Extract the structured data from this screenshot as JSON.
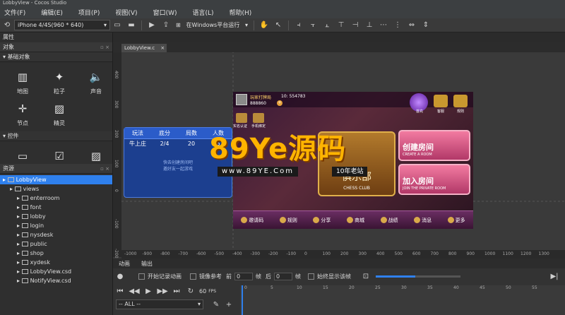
{
  "window": {
    "title": "LobbyView - Cocos Studio"
  },
  "menu": [
    "文件(F)",
    "编辑(E)",
    "项目(P)",
    "视图(V)",
    "窗口(W)",
    "语言(L)",
    "帮助(H)"
  ],
  "toolbar": {
    "device": "iPhone 4/4S(960 * 640)",
    "run_target": "在Windows平台运行"
  },
  "properties_label": "属性",
  "objects_panel": {
    "title": "对象",
    "basic_section": "基础对象",
    "basic_items": [
      {
        "label": "地图",
        "icon": "map-icon"
      },
      {
        "label": "粒子",
        "icon": "particle-icon"
      },
      {
        "label": "声音",
        "icon": "sound-icon"
      },
      {
        "label": "节点",
        "icon": "node-icon"
      },
      {
        "label": "精灵",
        "icon": "sprite-icon"
      }
    ],
    "controls_section": "控件",
    "control_items": [
      {
        "label": "按钮",
        "icon": "button-icon"
      },
      {
        "label": "复选框",
        "icon": "checkbox-icon"
      },
      {
        "label": "图片",
        "icon": "image-icon"
      }
    ]
  },
  "resources_panel": {
    "title": "资源",
    "root": "LobbyView",
    "items": [
      "views",
      "enterroom",
      "font",
      "lobby",
      "login",
      "nysdesk",
      "public",
      "shop",
      "xydesk",
      "LobbyView.csd",
      "NotifyView.csd"
    ]
  },
  "editor_tab": "LobbyView.c",
  "ruler": {
    "v_ticks": [
      "400",
      "300",
      "200",
      "100",
      "0",
      "-100",
      "-200"
    ],
    "h_ticks": [
      "-1000",
      "-900",
      "-800",
      "-700",
      "-600",
      "-500",
      "-400",
      "-300",
      "-200",
      "-100",
      "0",
      "100",
      "200",
      "300",
      "400",
      "500",
      "600",
      "700",
      "800",
      "900",
      "1000",
      "1100",
      "1200",
      "1300"
    ]
  },
  "side_table": {
    "headers": [
      "玩法",
      "底分",
      "局数",
      "人数"
    ],
    "row": [
      "牛上庄",
      "2/4",
      "20",
      "6"
    ],
    "empty_text": "快去创建房间吧",
    "empty_sub": "邀好友一起游戏"
  },
  "game": {
    "player_name": "玩家打牌局",
    "player_id": "10: 554783",
    "coins": "888860",
    "top_icons": [
      "首充",
      "客服",
      "规则"
    ],
    "rooms": [
      {
        "title": "创建房间",
        "sub": "CREATE A ROOM"
      },
      {
        "title": "加入房间",
        "sub": "JOIN THE PRIVATE ROOM"
      }
    ],
    "club": {
      "title": "俱乐部",
      "sub": "CHESS CLUB"
    },
    "bottom": [
      "邀请码",
      "规则",
      "分享",
      "商城",
      "战绩",
      "消息",
      "更多"
    ],
    "left_icons": [
      "实名认证",
      "手机绑定"
    ]
  },
  "watermark": {
    "brand": "89Ye源码",
    "url": "www.89YE.Com",
    "tag": "10年老站"
  },
  "animation_panel": {
    "tabs": [
      "动画",
      "输出"
    ],
    "record": "开始记录动画",
    "mirror": "镜像参考",
    "prev": "前",
    "prev_val": "0",
    "frame": "帧",
    "next": "后",
    "next_val": "0",
    "always_show": "始终显示该帧",
    "fps_val": "60",
    "fps": "FPS",
    "filter": "-- ALL --",
    "ticks": [
      "0",
      "5",
      "10",
      "15",
      "20",
      "25",
      "30",
      "35",
      "40",
      "45",
      "50",
      "55"
    ]
  }
}
